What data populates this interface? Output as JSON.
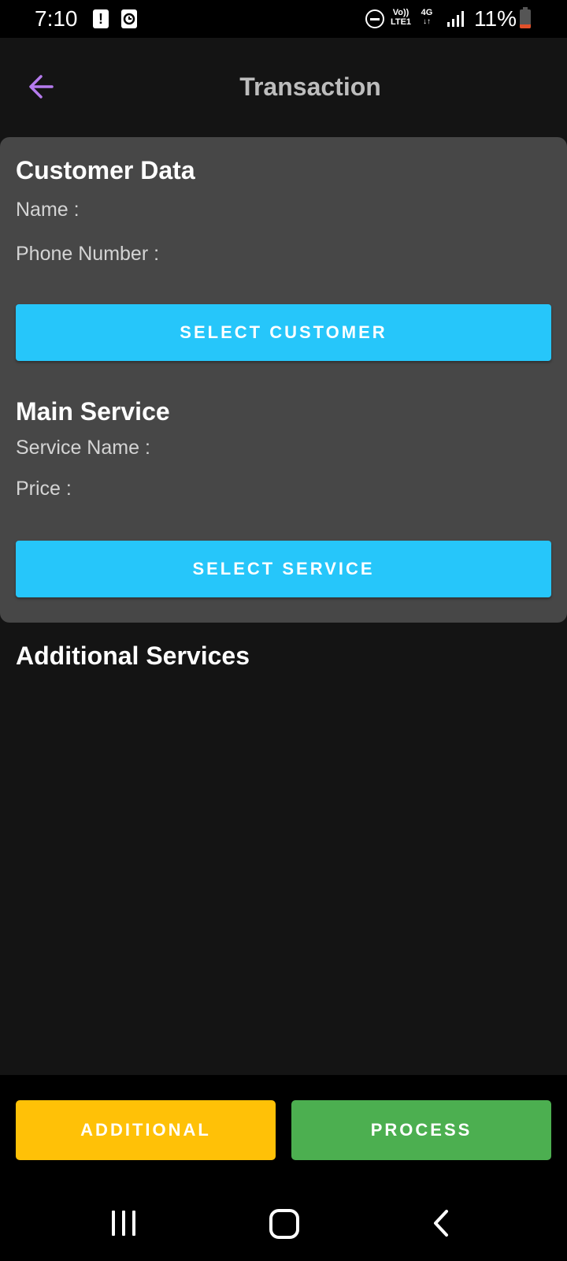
{
  "status_bar": {
    "time": "7:10",
    "notif_icon_1": "!",
    "volte_label": "Vo))",
    "lte_label": "LTE1",
    "net_label": "4G",
    "battery_text": "11%",
    "icons": [
      "alert-icon",
      "clock-icon",
      "dnd-icon",
      "volte-icon",
      "4g-icon",
      "signal-icon",
      "battery-icon"
    ]
  },
  "header": {
    "title": "Transaction",
    "back_icon": "arrow-left-icon",
    "back_color": "#b57bee"
  },
  "customer": {
    "section_title": "Customer Data",
    "name_label": "Name :",
    "phone_label": "Phone Number :",
    "select_button": "SELECT CUSTOMER"
  },
  "main_service": {
    "section_title": "Main Service",
    "service_name_label": "Service Name :",
    "price_label": "Price :",
    "select_button": "SELECT SERVICE"
  },
  "additional_services": {
    "section_title": "Additional Services"
  },
  "actions": {
    "additional_label": "ADDITIONAL",
    "process_label": "PROCESS",
    "additional_color": "#ffc107",
    "process_color": "#4caf50"
  },
  "colors": {
    "accent": "#26c6fa",
    "background": "#141414",
    "card": "#474747"
  },
  "nav_bar": {
    "icons": [
      "recents-icon",
      "home-icon",
      "back-icon"
    ]
  }
}
